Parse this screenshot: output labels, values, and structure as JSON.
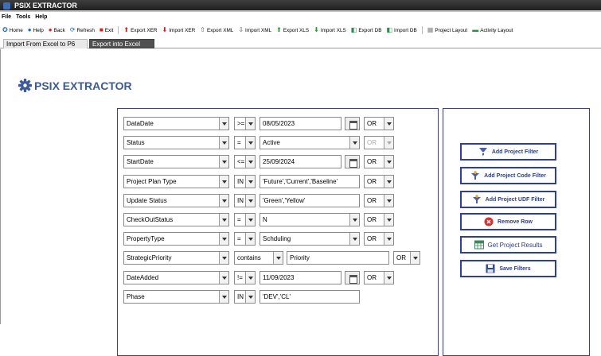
{
  "window": {
    "title": "PSIX EXTRACTOR"
  },
  "menu": [
    "File",
    "Tools",
    "Help"
  ],
  "toolbar": [
    {
      "icon": "home-icon",
      "glyph": "✪",
      "color": "#1e63c6",
      "label": "Home"
    },
    {
      "icon": "help-icon",
      "glyph": "●",
      "color": "#1e63c6",
      "label": "Help"
    },
    {
      "icon": "back-icon",
      "glyph": "●",
      "color": "#d62020",
      "label": "Back"
    },
    {
      "icon": "refresh-icon",
      "glyph": "⟳",
      "color": "#1e63c6",
      "label": "Refresh"
    },
    {
      "icon": "exit-icon",
      "glyph": "■",
      "color": "#d62020",
      "label": "Exit"
    },
    {
      "sep": true
    },
    {
      "icon": "export-xer-icon",
      "glyph": "⬆",
      "color": "#d62020",
      "label": "Export XER"
    },
    {
      "icon": "import-xer-icon",
      "glyph": "⬇",
      "color": "#d62020",
      "label": "Import XER"
    },
    {
      "icon": "export-xml-icon",
      "glyph": "⇧",
      "color": "#555555",
      "label": "Export XML"
    },
    {
      "icon": "import-xml-icon",
      "glyph": "⇩",
      "color": "#555555",
      "label": "Import XML"
    },
    {
      "icon": "export-xls-icon",
      "glyph": "⬆",
      "color": "#1f9a32",
      "label": "Export XLS"
    },
    {
      "icon": "import-xls-icon",
      "glyph": "⬇",
      "color": "#1f9a32",
      "label": "Import XLS"
    },
    {
      "icon": "export-db-icon",
      "glyph": "◧",
      "color": "#2a8a4a",
      "label": "Export DB"
    },
    {
      "icon": "import-db-icon",
      "glyph": "◧",
      "color": "#2a8a4a",
      "label": "Import DB"
    },
    {
      "sep": true
    },
    {
      "icon": "project-layout-icon",
      "glyph": "▦",
      "color": "#888888",
      "label": "Project Layout"
    },
    {
      "icon": "activity-layout-icon",
      "glyph": "▬",
      "color": "#1f9a32",
      "label": "Activity Layout"
    }
  ],
  "tabs": [
    {
      "label": "Import From Excel to P6",
      "active": false
    },
    {
      "label": "Export into Excel",
      "active": true
    }
  ],
  "logo_text": "PSIX EXTRACTOR",
  "filters": [
    {
      "field": "DataDate",
      "op": ">=",
      "value": "08/05/2023",
      "kind": "date",
      "logic": "OR",
      "logic_enabled": true
    },
    {
      "field": "Status",
      "op": "=",
      "value": "Active",
      "kind": "select",
      "logic": "OR",
      "logic_enabled": false
    },
    {
      "field": "StartDate",
      "op": "<=",
      "value": "25/09/2024",
      "kind": "date",
      "logic": "OR",
      "logic_enabled": true
    },
    {
      "field": "Project Plan Type",
      "op": "IN",
      "value": "'Future','Current','Baseline'",
      "kind": "text",
      "logic": "OR",
      "logic_enabled": true
    },
    {
      "field": "Update Status",
      "op": "IN",
      "value": "'Green','Yellow'",
      "kind": "text",
      "logic": "OR",
      "logic_enabled": true
    },
    {
      "field": "CheckOutStatus",
      "op": "=",
      "value": "N",
      "kind": "select",
      "logic": "OR",
      "logic_enabled": true
    },
    {
      "field": "PropertyType",
      "op": "=",
      "value": "Schduling",
      "kind": "select",
      "logic": "OR",
      "logic_enabled": true
    },
    {
      "field": "StrategicPriority",
      "op": "contains",
      "value": "Priority",
      "kind": "wide",
      "logic": "OR",
      "logic_enabled": true
    },
    {
      "field": "DateAdded",
      "op": "!=",
      "value": "11/09/2023",
      "kind": "date",
      "logic": "OR",
      "logic_enabled": true
    },
    {
      "field": "Phase",
      "op": "IN",
      "value": "'DEV','CL'",
      "kind": "text",
      "logic": null,
      "logic_enabled": true
    }
  ],
  "actions": [
    {
      "name": "add-project-filter-button",
      "icon": "funnel-down-icon",
      "label": "Add Project Filter"
    },
    {
      "name": "add-project-code-filter-button",
      "icon": "funnel-plus-icon",
      "label": "Add Project Code Filter"
    },
    {
      "name": "add-project-udf-filter-button",
      "icon": "funnel-plus-icon",
      "label": "Add Project UDF Filter"
    },
    {
      "name": "remove-row-button",
      "icon": "remove-icon",
      "label": "Remove Row"
    },
    {
      "name": "get-project-results-button",
      "icon": "spreadsheet-icon",
      "label": "Get Project Results"
    },
    {
      "name": "save-filters-button",
      "icon": "save-icon",
      "label": "Save Filters"
    }
  ],
  "colors": {
    "accent": "#3c5a99",
    "panel_border": "#3c3ca8",
    "remove": "#e02c2c"
  }
}
